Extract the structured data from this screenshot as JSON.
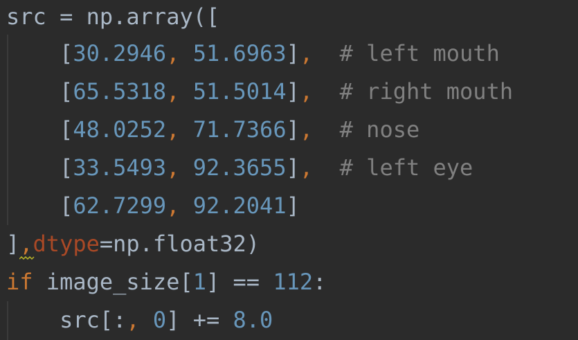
{
  "editor": {
    "colors": {
      "background": "#2b2b2b",
      "plain": "#a9b7c6",
      "number": "#6897bb",
      "keyword": "#cc7832",
      "comment": "#808080",
      "named_arg": "#aa4926",
      "warning_squiggle": "#bbb529"
    },
    "lines": [
      {
        "tokens": [
          {
            "t": "src = np.array([",
            "k": "plain"
          }
        ]
      },
      {
        "tokens": [
          {
            "t": "    [",
            "k": "plain"
          },
          {
            "t": "30.2946",
            "k": "num"
          },
          {
            "t": ",",
            "k": "punc"
          },
          {
            "t": " ",
            "k": "plain"
          },
          {
            "t": "51.6963",
            "k": "num"
          },
          {
            "t": "]",
            "k": "plain"
          },
          {
            "t": ",",
            "k": "punc"
          },
          {
            "t": "  ",
            "k": "plain"
          },
          {
            "t": "# left mouth",
            "k": "cmt"
          }
        ]
      },
      {
        "tokens": [
          {
            "t": "    [",
            "k": "plain"
          },
          {
            "t": "65.5318",
            "k": "num"
          },
          {
            "t": ",",
            "k": "punc"
          },
          {
            "t": " ",
            "k": "plain"
          },
          {
            "t": "51.5014",
            "k": "num"
          },
          {
            "t": "]",
            "k": "plain"
          },
          {
            "t": ",",
            "k": "punc"
          },
          {
            "t": "  ",
            "k": "plain"
          },
          {
            "t": "# right mouth",
            "k": "cmt"
          }
        ]
      },
      {
        "tokens": [
          {
            "t": "    [",
            "k": "plain"
          },
          {
            "t": "48.0252",
            "k": "num"
          },
          {
            "t": ",",
            "k": "punc"
          },
          {
            "t": " ",
            "k": "plain"
          },
          {
            "t": "71.7366",
            "k": "num"
          },
          {
            "t": "]",
            "k": "plain"
          },
          {
            "t": ",",
            "k": "punc"
          },
          {
            "t": "  ",
            "k": "plain"
          },
          {
            "t": "# nose",
            "k": "cmt"
          }
        ]
      },
      {
        "tokens": [
          {
            "t": "    [",
            "k": "plain"
          },
          {
            "t": "33.5493",
            "k": "num"
          },
          {
            "t": ",",
            "k": "punc"
          },
          {
            "t": " ",
            "k": "plain"
          },
          {
            "t": "92.3655",
            "k": "num"
          },
          {
            "t": "]",
            "k": "plain"
          },
          {
            "t": ",",
            "k": "punc"
          },
          {
            "t": "  ",
            "k": "plain"
          },
          {
            "t": "# left eye",
            "k": "cmt"
          }
        ]
      },
      {
        "tokens": [
          {
            "t": "    [",
            "k": "plain"
          },
          {
            "t": "62.7299",
            "k": "num"
          },
          {
            "t": ",",
            "k": "punc"
          },
          {
            "t": " ",
            "k": "plain"
          },
          {
            "t": "92.2041",
            "k": "num"
          },
          {
            "t": "]",
            "k": "plain"
          }
        ]
      },
      {
        "tokens": [
          {
            "t": "]",
            "k": "plain"
          },
          {
            "t": ",",
            "k": "punc"
          },
          {
            "t": "dtype",
            "k": "param"
          },
          {
            "t": "=np.float32)",
            "k": "plain"
          }
        ]
      },
      {
        "tokens": [
          {
            "t": "if",
            "k": "kw"
          },
          {
            "t": " image_size[",
            "k": "plain"
          },
          {
            "t": "1",
            "k": "num"
          },
          {
            "t": "] == ",
            "k": "plain"
          },
          {
            "t": "112",
            "k": "num"
          },
          {
            "t": ":",
            "k": "plain"
          }
        ]
      },
      {
        "tokens": [
          {
            "t": "    src[:",
            "k": "plain"
          },
          {
            "t": ",",
            "k": "punc"
          },
          {
            "t": " ",
            "k": "plain"
          },
          {
            "t": "0",
            "k": "num"
          },
          {
            "t": "] += ",
            "k": "plain"
          },
          {
            "t": "8.0",
            "k": "num"
          }
        ]
      }
    ]
  }
}
